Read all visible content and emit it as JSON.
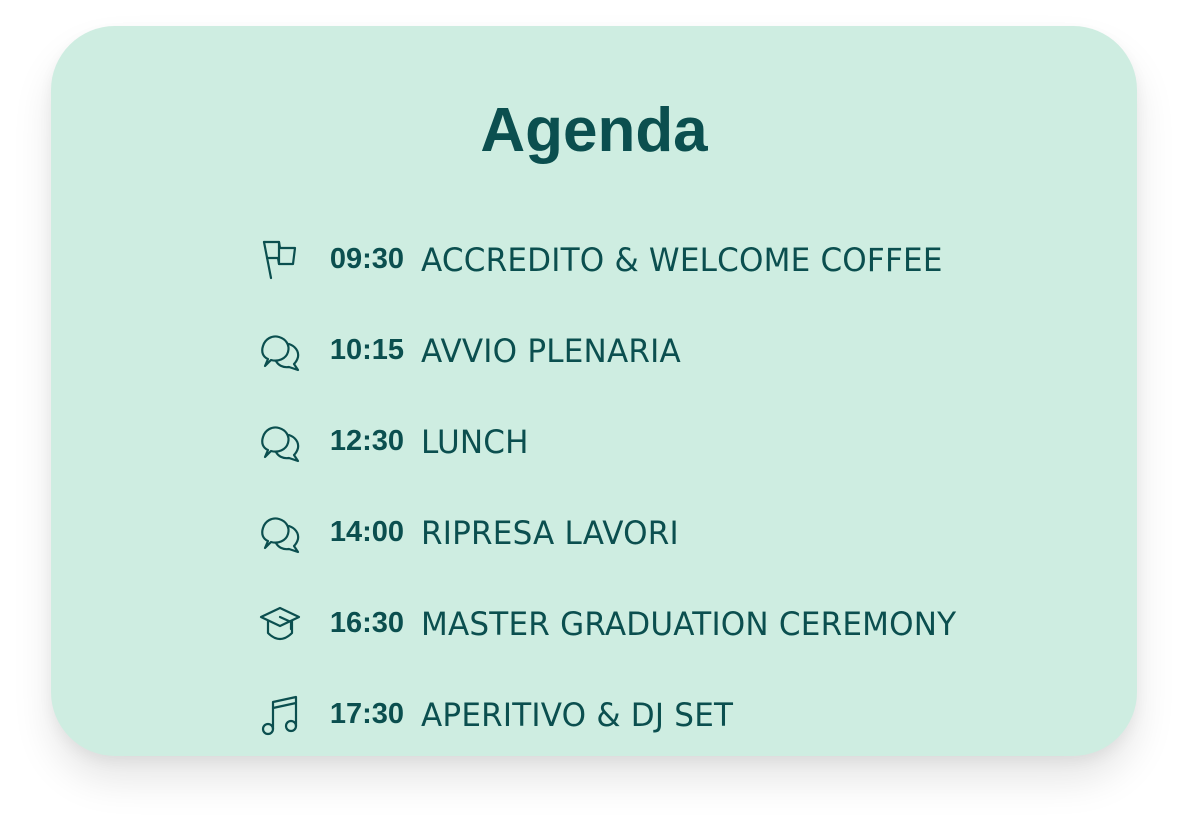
{
  "title": "Agenda",
  "colors": {
    "card_background": "#ceede1",
    "text": "#0b4f4f"
  },
  "items": [
    {
      "icon": "flag-icon",
      "time": "09:30",
      "event": "ACCREDITO & WELCOME COFFEE"
    },
    {
      "icon": "speech-bubbles-icon",
      "time": "10:15",
      "event": "AVVIO PLENARIA"
    },
    {
      "icon": "speech-bubbles-icon",
      "time": "12:30",
      "event": "LUNCH"
    },
    {
      "icon": "speech-bubbles-icon",
      "time": "14:00",
      "event": "RIPRESA LAVORI"
    },
    {
      "icon": "graduation-cap-icon",
      "time": "16:30",
      "event": "MASTER GRADUATION CEREMONY"
    },
    {
      "icon": "music-note-icon",
      "time": "17:30",
      "event": "APERITIVO & DJ SET"
    }
  ]
}
